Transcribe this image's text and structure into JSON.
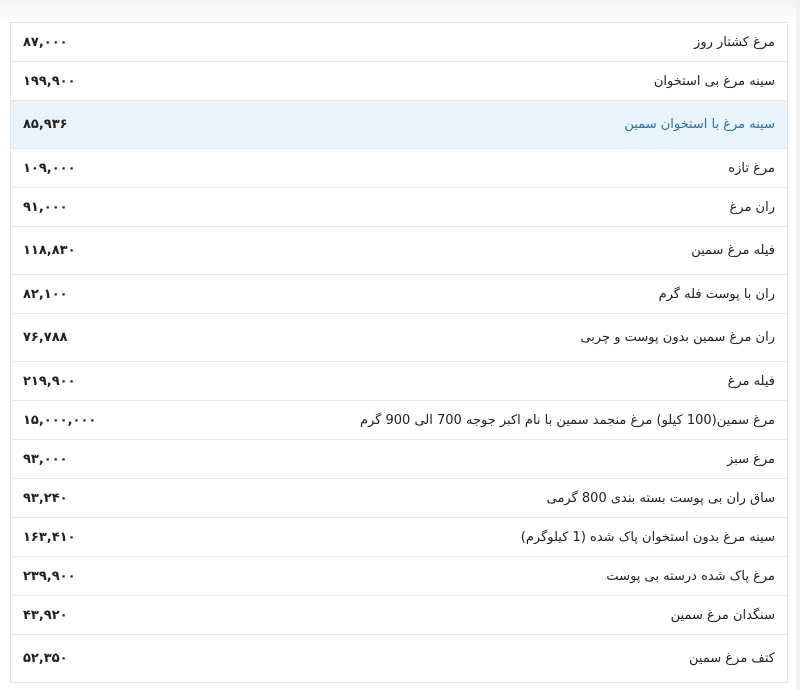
{
  "rows": [
    {
      "name": "مرغ کشتار روز",
      "price": "۸۷,۰۰۰"
    },
    {
      "name": "سینه مرغ بی استخوان",
      "price": "۱۹۹,۹۰۰"
    },
    {
      "name": "سینه مرغ با استخوان سمین",
      "price": "۸۵,۹۳۶"
    },
    {
      "name": "مرغ تازه",
      "price": "۱۰۹,۰۰۰"
    },
    {
      "name": "ران مرغ",
      "price": "۹۱,۰۰۰"
    },
    {
      "name": "فیله مرغ سمین",
      "price": "۱۱۸,۸۳۰"
    },
    {
      "name": "ران با پوست فله گرم",
      "price": "۸۲,۱۰۰"
    },
    {
      "name": "ران مرغ سمین بدون پوست و چربی",
      "price": "۷۶,۷۸۸"
    },
    {
      "name": "فیله مرغ",
      "price": "۲۱۹,۹۰۰"
    },
    {
      "name": "مرغ سمین(100 کیلو) مرغ منجمد سمین با نام اکبر جوجه 700 الی 900 گرم",
      "price": "۱۵,۰۰۰,۰۰۰"
    },
    {
      "name": "مرغ سبز",
      "price": "۹۳,۰۰۰"
    },
    {
      "name": "ساق ران بی پوست بسته بندی 800 گرمی",
      "price": "۹۳,۲۴۰"
    },
    {
      "name": "سینه مرغ بدون استخوان پاک شده (1 کیلوگرم)",
      "price": "۱۶۳,۴۱۰"
    },
    {
      "name": "مرغ پاک شده درسته بی پوست",
      "price": "۲۳۹,۹۰۰"
    },
    {
      "name": "سنگدان مرغ سمین",
      "price": "۴۳,۹۲۰"
    },
    {
      "name": "کتف مرغ سمین",
      "price": "۵۲,۳۵۰"
    }
  ]
}
